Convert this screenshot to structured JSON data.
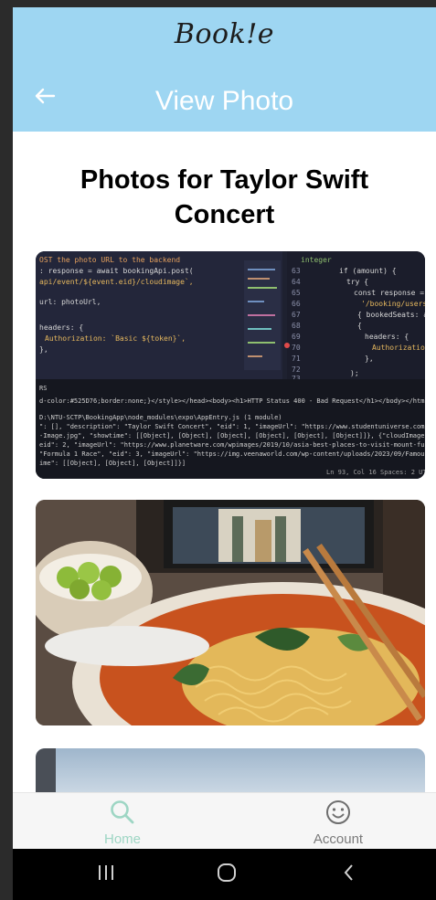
{
  "app": {
    "brand": "Book!e"
  },
  "header": {
    "title": "View Photo"
  },
  "page": {
    "title": "Photos for Taylor Swift Concert"
  },
  "photos": [
    {
      "description": "Screenshot of code editor showing POST request to booking backend"
    },
    {
      "description": "Bowl of ramen noodles with chopsticks and grapes in front of a laptop"
    },
    {
      "description": "Sky photo (partially visible)"
    }
  ],
  "tabs": [
    {
      "label": "Home",
      "icon": "search-icon",
      "active": true
    },
    {
      "label": "Account",
      "icon": "smiley-icon",
      "active": false
    }
  ],
  "colors": {
    "header_bg": "#9ed6f2",
    "tab_active": "#9ed6c4",
    "tab_inactive": "#7a7a7a"
  }
}
